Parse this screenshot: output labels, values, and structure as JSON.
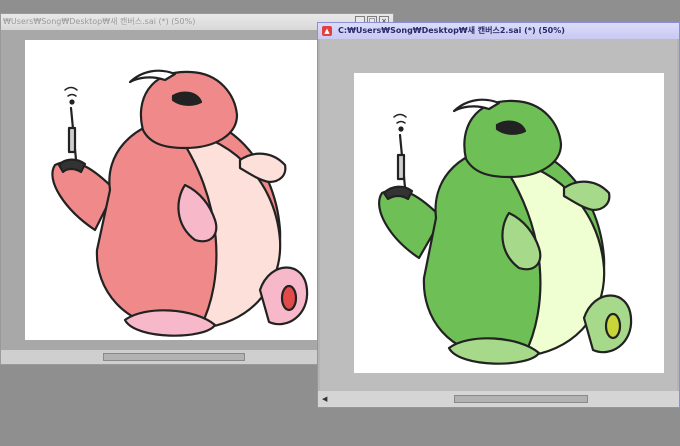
{
  "windows": [
    {
      "title": "₩Users₩Song₩Desktop₩새 캔버스.sai (*) (50%)",
      "art_palette": "pink",
      "colors": {
        "body": "#f08a8a",
        "belly": "#fde0da",
        "accent": "#f7b9c9",
        "spine": "#e55a5a"
      }
    },
    {
      "title": "C:₩Users₩Song₩Desktop₩새 캔버스2.sai (*) (50%)",
      "art_palette": "green",
      "colors": {
        "body": "#6fbf57",
        "belly": "#efffd2",
        "accent": "#a6d98a",
        "spine": "#3e9a34"
      }
    }
  ],
  "controls": {
    "minimize": "_",
    "maximize": "□",
    "close": "×"
  },
  "scroll_left_arrow": "◀"
}
